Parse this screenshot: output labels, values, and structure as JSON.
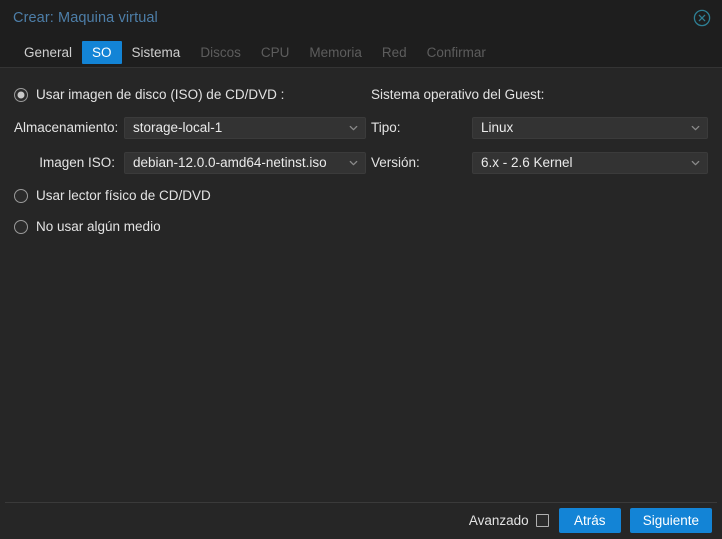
{
  "window": {
    "title": "Crear: Maquina virtual",
    "close_icon": "close-circle-icon"
  },
  "tabs": [
    {
      "label": "General",
      "state": "normal"
    },
    {
      "label": "SO",
      "state": "active"
    },
    {
      "label": "Sistema",
      "state": "normal"
    },
    {
      "label": "Discos",
      "state": "disabled"
    },
    {
      "label": "CPU",
      "state": "disabled"
    },
    {
      "label": "Memoria",
      "state": "disabled"
    },
    {
      "label": "Red",
      "state": "disabled"
    },
    {
      "label": "Confirmar",
      "state": "disabled"
    }
  ],
  "left": {
    "option_iso": "Usar imagen de disco (ISO) de CD/DVD :",
    "option_physical": "Usar lector físico de CD/DVD",
    "option_none": "No usar algún medio",
    "storage_label": "Almacenamiento:",
    "storage_value": "storage-local-1",
    "iso_label": "Imagen ISO:",
    "iso_value": "debian-12.0.0-amd64-netinst.iso"
  },
  "right": {
    "section_title": "Sistema operativo del Guest:",
    "type_label": "Tipo:",
    "type_value": "Linux",
    "version_label": "Versión:",
    "version_value": "6.x - 2.6 Kernel"
  },
  "footer": {
    "advanced_label": "Avanzado",
    "back_label": "Atrás",
    "next_label": "Siguiente"
  },
  "colors": {
    "accent": "#1384d6",
    "title_text": "#4d7ea8",
    "background": "#262626",
    "header_background": "#1e1e1e",
    "field_background": "#333333",
    "disabled_text": "#5d5d5d"
  }
}
